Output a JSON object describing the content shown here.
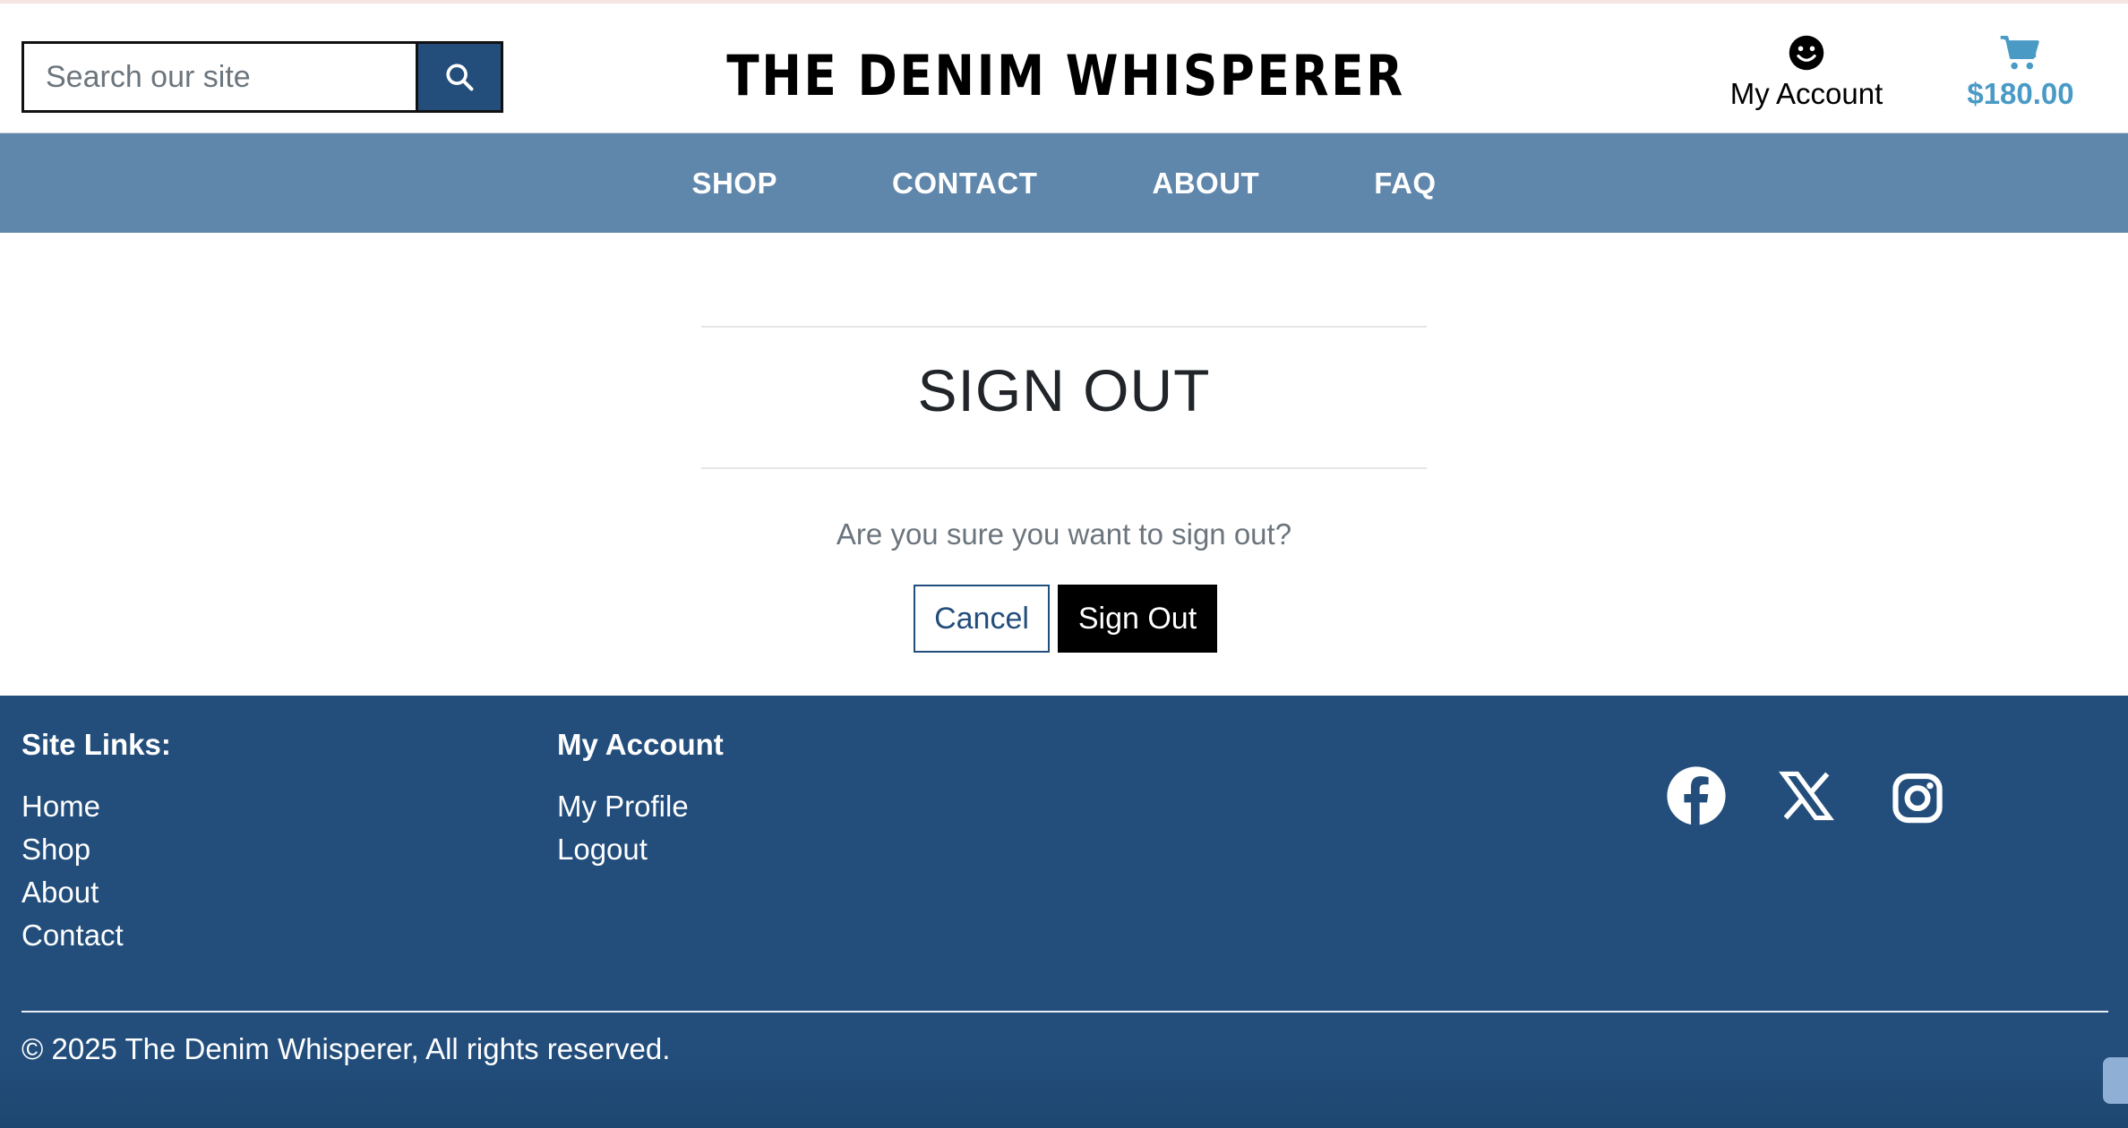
{
  "header": {
    "search_placeholder": "Search our site",
    "logo_text": "THE DENIM WHISPERER",
    "account_label": "My Account",
    "cart_total": "$180.00",
    "icons": {
      "search": "search-icon",
      "account": "smiley-icon",
      "cart": "shopping-cart-icon"
    }
  },
  "nav": {
    "items": [
      {
        "label": "SHOP"
      },
      {
        "label": "CONTACT"
      },
      {
        "label": "ABOUT"
      },
      {
        "label": "FAQ"
      }
    ]
  },
  "main": {
    "title": "SIGN OUT",
    "question": "Are you sure you want to sign out?",
    "cancel_label": "Cancel",
    "signout_label": "Sign Out"
  },
  "footer": {
    "site_links_heading": "Site Links:",
    "site_links": [
      {
        "label": "Home"
      },
      {
        "label": "Shop"
      },
      {
        "label": "About"
      },
      {
        "label": "Contact"
      }
    ],
    "account_heading": "My Account",
    "account_links": [
      {
        "label": "My Profile"
      },
      {
        "label": "Logout"
      }
    ],
    "social": [
      "facebook-icon",
      "x-icon",
      "instagram-icon"
    ],
    "copyright": "© 2025 The Denim Whisperer, All rights reserved."
  },
  "colors": {
    "brand_dark_blue": "#234e7c",
    "nav_blue": "#5f86ab",
    "cart_blue": "#4a9ac6",
    "signout_black": "#000000"
  }
}
